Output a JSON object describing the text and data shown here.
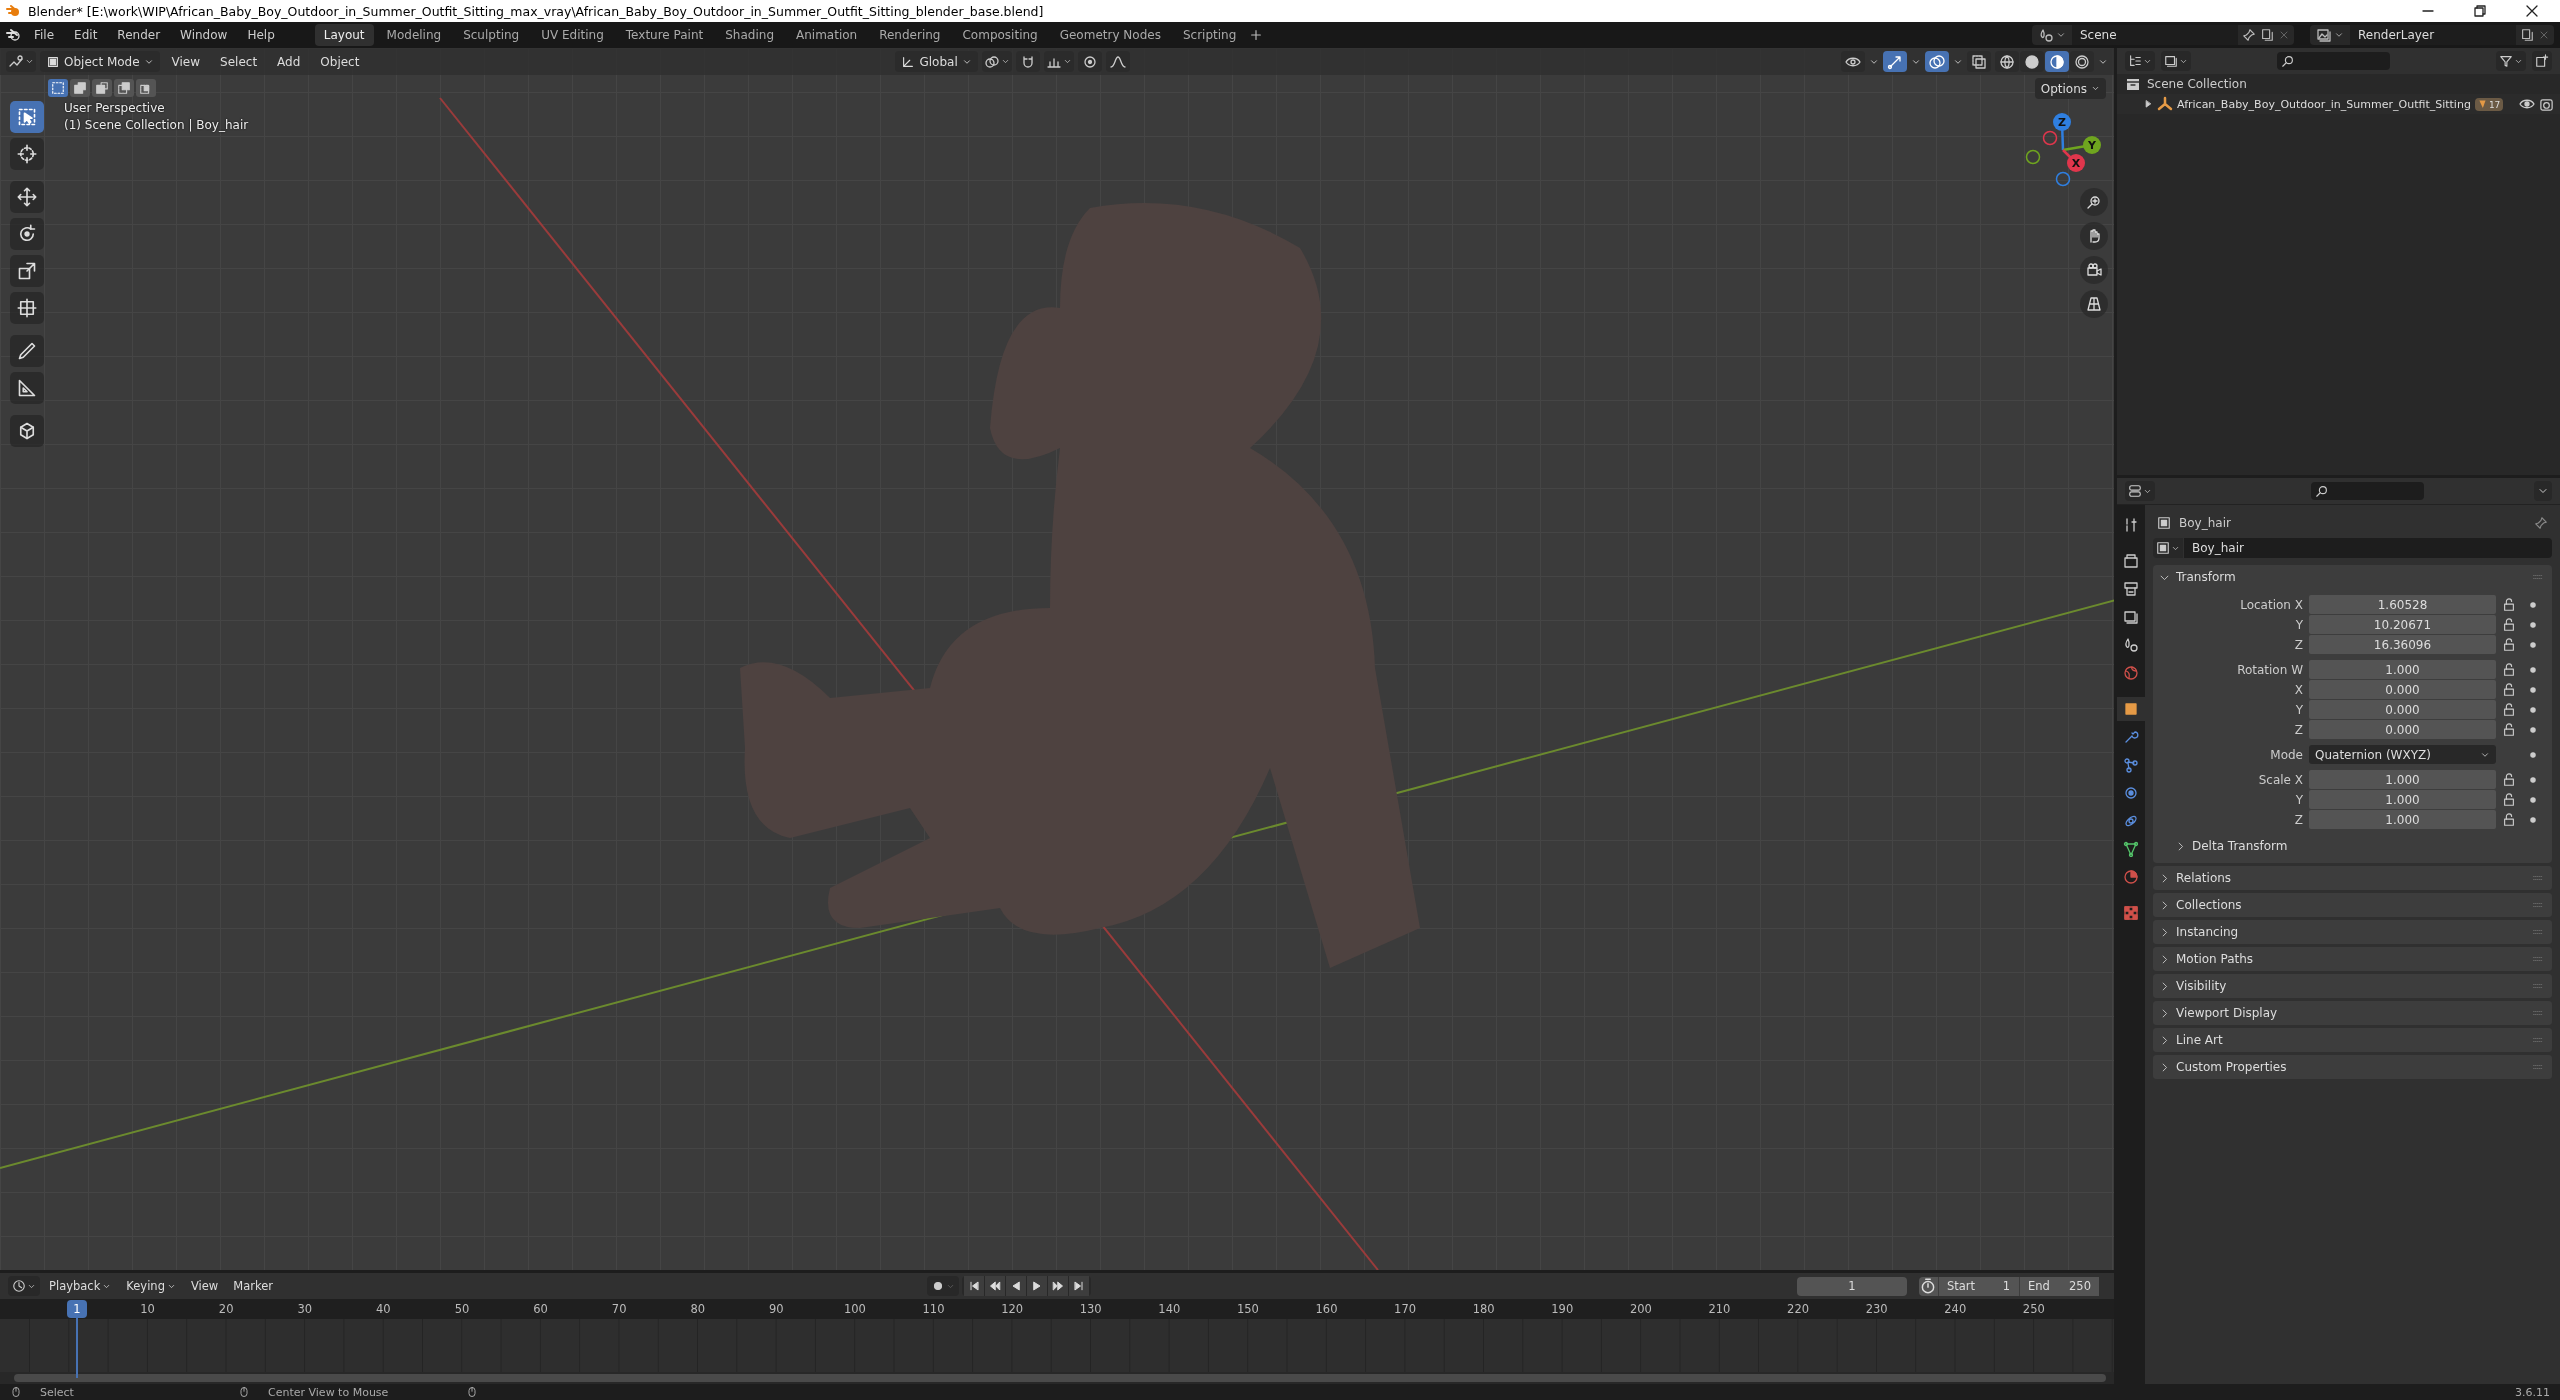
{
  "window": {
    "title": "Blender* [E:\\work\\WIP\\African_Baby_Boy_Outdoor_in_Summer_Outfit_Sitting_max_vray\\African_Baby_Boy_Outdoor_in_Summer_Outfit_Sitting_blender_base.blend]"
  },
  "menu": [
    "File",
    "Edit",
    "Render",
    "Window",
    "Help"
  ],
  "workspaces": [
    {
      "label": "Layout",
      "selected": true
    },
    {
      "label": "Modeling",
      "selected": false
    },
    {
      "label": "Sculpting",
      "selected": false
    },
    {
      "label": "UV Editing",
      "selected": false
    },
    {
      "label": "Texture Paint",
      "selected": false
    },
    {
      "label": "Shading",
      "selected": false
    },
    {
      "label": "Animation",
      "selected": false
    },
    {
      "label": "Rendering",
      "selected": false
    },
    {
      "label": "Compositing",
      "selected": false
    },
    {
      "label": "Geometry Nodes",
      "selected": false
    },
    {
      "label": "Scripting",
      "selected": false
    }
  ],
  "scene": {
    "name": "Scene",
    "view_layer": "RenderLayer"
  },
  "viewport": {
    "mode": "Object Mode",
    "menus": [
      "View",
      "Select",
      "Add",
      "Object"
    ],
    "orientation": "Global",
    "options": "Options",
    "view_name": "User Perspective",
    "context": "(1) Scene Collection | Boy_hair",
    "select_modes": [
      {
        "kind": "set",
        "selected": true
      },
      {
        "kind": "extend",
        "selected": false
      },
      {
        "kind": "subtract",
        "selected": false
      },
      {
        "kind": "invert",
        "selected": false
      },
      {
        "kind": "intersect",
        "selected": false
      }
    ],
    "tools": [
      {
        "kind": "select",
        "selected": true
      },
      {
        "kind": "cursor",
        "selected": false
      },
      {
        "kind": "move",
        "selected": false
      },
      {
        "kind": "rotate",
        "selected": false
      },
      {
        "kind": "scale",
        "selected": false
      },
      {
        "kind": "transform",
        "selected": false
      },
      {
        "kind": "annotate",
        "selected": false
      },
      {
        "kind": "measure",
        "selected": false
      },
      {
        "kind": "add_cube",
        "selected": false
      }
    ],
    "toggles": [
      {
        "kind": "visibility",
        "on": false
      },
      {
        "kind": "gizmo",
        "on": true
      },
      {
        "kind": "overlay",
        "on": true
      },
      {
        "kind": "xray",
        "on": false
      }
    ],
    "shading": [
      {
        "kind": "wireframe",
        "selected": false
      },
      {
        "kind": "solid",
        "selected": false
      },
      {
        "kind": "material",
        "selected": true
      },
      {
        "kind": "rendered",
        "selected": false
      }
    ],
    "axes": [
      {
        "label": "Z",
        "color": "#2f7fe0"
      },
      {
        "label": "Y",
        "color": "#6fa51f"
      },
      {
        "label": "X",
        "color": "#e0364c"
      }
    ]
  },
  "outliner": {
    "root": "Scene Collection",
    "items": [
      {
        "label": "African_Baby_Boy_Outdoor_in_Summer_Outfit_Sitting",
        "expanded": false,
        "badge": "17"
      }
    ]
  },
  "properties": {
    "object": "Boy_hair",
    "data_name": "Boy_hair",
    "tabs": [
      {
        "kind": "tool",
        "selected": false
      },
      {
        "kind": "render",
        "selected": false
      },
      {
        "kind": "output",
        "selected": false
      },
      {
        "kind": "view_layer",
        "selected": false
      },
      {
        "kind": "scene",
        "selected": false
      },
      {
        "kind": "world",
        "selected": false
      },
      {
        "kind": "object",
        "selected": true
      },
      {
        "kind": "modifiers",
        "selected": false
      },
      {
        "kind": "particles",
        "selected": false
      },
      {
        "kind": "physics",
        "selected": false
      },
      {
        "kind": "constraints",
        "selected": false
      },
      {
        "kind": "data",
        "selected": false
      },
      {
        "kind": "material",
        "selected": false
      },
      {
        "kind": "texture",
        "selected": false
      }
    ],
    "transform": {
      "title": "Transform",
      "expanded": true,
      "groups": [
        [
          {
            "kind": "number",
            "label": "Location X",
            "value": "1.60528"
          },
          {
            "kind": "number",
            "label": "Y",
            "value": "10.20671"
          },
          {
            "kind": "number",
            "label": "Z",
            "value": "16.36096"
          }
        ],
        [
          {
            "kind": "number",
            "label": "Rotation W",
            "value": "1.000"
          },
          {
            "kind": "number",
            "label": "X",
            "value": "0.000"
          },
          {
            "kind": "number",
            "label": "Y",
            "value": "0.000"
          },
          {
            "kind": "number",
            "label": "Z",
            "value": "0.000"
          }
        ],
        [
          {
            "kind": "dropdown",
            "label": "Mode",
            "value": "Quaternion (WXYZ)"
          }
        ],
        [
          {
            "kind": "number",
            "label": "Scale X",
            "value": "1.000"
          },
          {
            "kind": "number",
            "label": "Y",
            "value": "1.000"
          },
          {
            "kind": "number",
            "label": "Z",
            "value": "1.000"
          }
        ]
      ],
      "subpanels": [
        {
          "title": "Delta Transform",
          "expanded": false
        }
      ]
    },
    "panels": [
      {
        "title": "Relations",
        "expanded": false
      },
      {
        "title": "Collections",
        "expanded": false
      },
      {
        "title": "Instancing",
        "expanded": false
      },
      {
        "title": "Motion Paths",
        "expanded": false
      },
      {
        "title": "Visibility",
        "expanded": false
      },
      {
        "title": "Viewport Display",
        "expanded": false
      },
      {
        "title": "Line Art",
        "expanded": false
      },
      {
        "title": "Custom Properties",
        "expanded": false
      }
    ]
  },
  "timeline": {
    "menus": [
      "Playback",
      "Keying",
      "View",
      "Marker"
    ],
    "frame_field": "1",
    "start_label": "Start",
    "start": "1",
    "end_label": "End",
    "end": "250",
    "playhead": "1",
    "ticks": [
      "10",
      "20",
      "30",
      "40",
      "50",
      "60",
      "70",
      "80",
      "90",
      "100",
      "110",
      "120",
      "130",
      "140",
      "150",
      "160",
      "170",
      "180",
      "190",
      "200",
      "210",
      "220",
      "230",
      "240",
      "250"
    ]
  },
  "status_bar": {
    "hints": [
      "Select",
      "Center View to Mouse"
    ],
    "version": "3.6.11"
  }
}
